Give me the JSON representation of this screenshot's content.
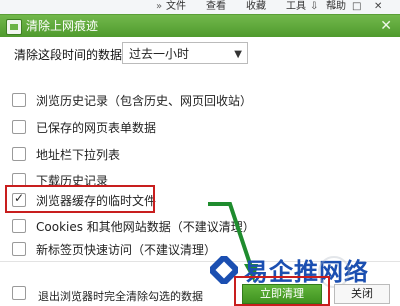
{
  "browser": {
    "menu": [
      "文件",
      "查看",
      "收藏",
      "工具",
      "帮助"
    ],
    "controls": [
      "⇩",
      "⌄",
      "□",
      "✕"
    ]
  },
  "dialog": {
    "title": "清除上网痕迹",
    "period_label": "清除这段时间的数据：",
    "period_value": "过去一小时",
    "items": [
      {
        "label": "浏览历史记录（包含历史、网页回收站）",
        "checked": false
      },
      {
        "label": "已保存的网页表单数据",
        "checked": false
      },
      {
        "label": "地址栏下拉列表",
        "checked": false
      },
      {
        "label": "下载历史记录",
        "checked": false
      },
      {
        "label": "浏览器缓存的临时文件",
        "checked": true
      },
      {
        "label": "Cookies 和其他网站数据（不建议清理）",
        "checked": false
      },
      {
        "label": "新标签页快速访问（不建议清理）",
        "checked": false
      }
    ],
    "footer_label": "退出浏览器时完全清除勾选的数据",
    "footer_checked": false,
    "primary_button": "立即清理",
    "close_button": "关闭"
  },
  "watermark": {
    "text": "易企推网络",
    "brand_color": "#1b4fb1"
  },
  "colors": {
    "accent": "#5aa836",
    "highlight": "#c81e1e"
  }
}
